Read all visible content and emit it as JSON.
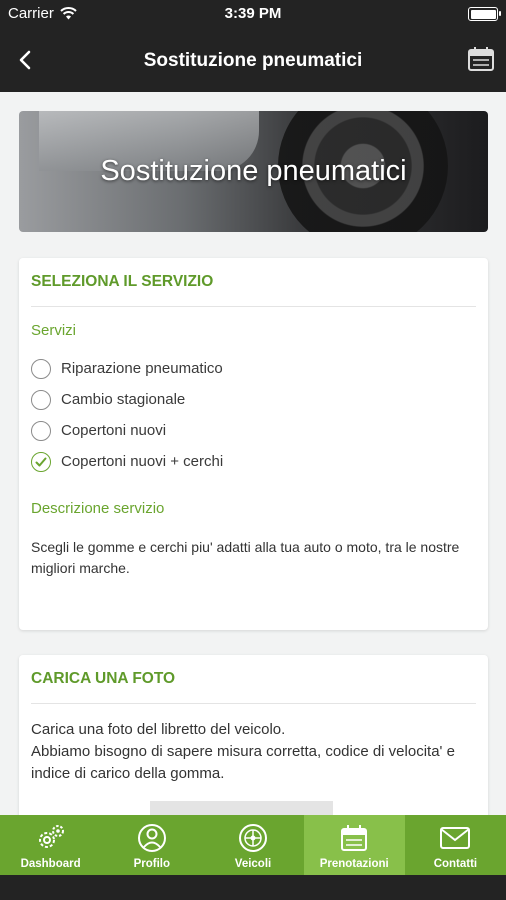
{
  "status_bar": {
    "carrier": "Carrier",
    "time": "3:39 PM",
    "battery_level": 1.0
  },
  "nav": {
    "title": "Sostituzione pneumatici",
    "back_icon": "chevron-left-icon",
    "action_icon": "calendar-icon"
  },
  "hero": {
    "title": "Sostituzione pneumatici"
  },
  "service_card": {
    "header": "SELEZIONA IL SERVIZIO",
    "services_label": "Servizi",
    "options": [
      {
        "label": "Riparazione pneumatico",
        "checked": false
      },
      {
        "label": "Cambio stagionale",
        "checked": false
      },
      {
        "label": "Copertoni nuovi",
        "checked": false
      },
      {
        "label": "Copertoni nuovi + cerchi",
        "checked": true
      }
    ],
    "description_label": "Descrizione servizio",
    "description_text": "Scegli le gomme e cerchi piu' adatti alla tua auto o moto, tra le nostre migliori marche."
  },
  "photo_card": {
    "header": "CARICA UNA FOTO",
    "line1": "Carica una foto del libretto del veicolo.",
    "line2": "Abbiamo bisogno di sapere misura corretta, codice di velocita' e indice di carico della gomma."
  },
  "tabs": [
    {
      "label": "Dashboard",
      "icon": "gears-icon",
      "active": false
    },
    {
      "label": "Profilo",
      "icon": "user-icon",
      "active": false
    },
    {
      "label": "Veicoli",
      "icon": "wheel-icon",
      "active": false
    },
    {
      "label": "Prenotazioni",
      "icon": "calendar-icon",
      "active": true
    },
    {
      "label": "Contatti",
      "icon": "envelope-icon",
      "active": false
    }
  ],
  "colors": {
    "accent": "#6aa52f",
    "accent_active": "#88c04a",
    "dark": "#232323",
    "background": "#f2f3f3"
  }
}
